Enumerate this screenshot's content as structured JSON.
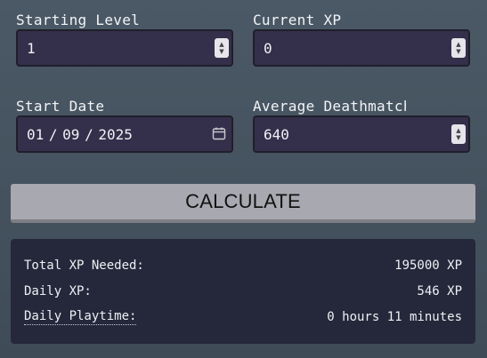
{
  "form": {
    "starting_level": {
      "label": "Starting Level",
      "value": "1"
    },
    "current_xp": {
      "label": "Current XP",
      "value": "0"
    },
    "start_date": {
      "label": "Start Date",
      "value": "01 / 09 / 2025"
    },
    "avg_deathmatch": {
      "label": "Average Deathmatch",
      "value": "640"
    }
  },
  "calculate_label": "CALCULATE",
  "results": {
    "total_xp": {
      "label": "Total XP Needed:",
      "value": "195000 XP"
    },
    "daily_xp": {
      "label": "Daily XP:",
      "value": "546 XP"
    },
    "daily_playtime": {
      "label": "Daily Playtime:",
      "value": "0 hours 11 minutes"
    }
  },
  "icons": {
    "spinner": "number-spinner-icon",
    "calendar": "calendar-icon"
  }
}
